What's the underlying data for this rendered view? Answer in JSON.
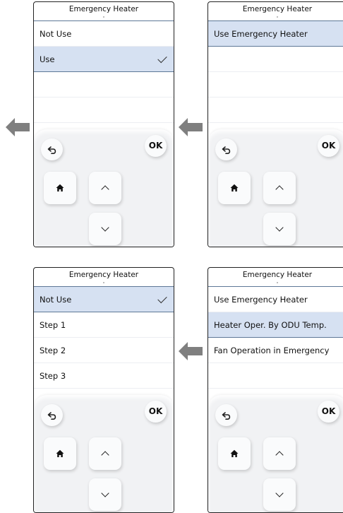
{
  "panel_tl": {
    "title": "Emergency Heater",
    "items": [
      {
        "label": "Not Use",
        "selected": false,
        "checked": false
      },
      {
        "label": "Use",
        "selected": true,
        "checked": true
      },
      {
        "label": "",
        "selected": false,
        "checked": false
      },
      {
        "label": "",
        "selected": false,
        "checked": false
      }
    ],
    "ok_label": "OK"
  },
  "panel_tr": {
    "title": "Emergency Heater",
    "items": [
      {
        "label": "Use Emergency Heater",
        "selected": true,
        "checked": false
      },
      {
        "label": "",
        "selected": false,
        "checked": false
      },
      {
        "label": "",
        "selected": false,
        "checked": false
      },
      {
        "label": "",
        "selected": false,
        "checked": false
      }
    ],
    "ok_label": "OK"
  },
  "panel_bl": {
    "title": "Emergency Heater",
    "items": [
      {
        "label": "Not Use",
        "selected": true,
        "checked": true
      },
      {
        "label": "Step 1",
        "selected": false,
        "checked": false
      },
      {
        "label": "Step 2",
        "selected": false,
        "checked": false
      },
      {
        "label": "Step 3",
        "selected": false,
        "checked": false
      }
    ],
    "ok_label": "OK"
  },
  "panel_br": {
    "title": "Emergency Heater",
    "items": [
      {
        "label": "Use Emergency Heater",
        "selected": false,
        "checked": false
      },
      {
        "label": "Heater Oper. By ODU Temp.",
        "selected": true,
        "checked": false
      },
      {
        "label": "Fan Operation in Emergency",
        "selected": false,
        "checked": false
      },
      {
        "label": "",
        "selected": false,
        "checked": false
      }
    ],
    "ok_label": "OK"
  },
  "colors": {
    "selected_bg": "#d6e1f2",
    "accent_line": "#5e7897",
    "flow_arrow": "#7f7f7f"
  },
  "icons": {
    "back": "back-arrow-icon",
    "home": "home-icon",
    "up": "chevron-up-icon",
    "down": "chevron-down-icon",
    "flow": "left-arrow-icon",
    "check": "checkmark-icon"
  }
}
